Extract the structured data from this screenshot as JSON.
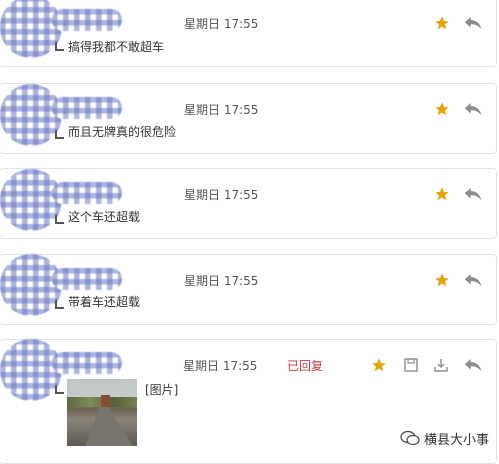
{
  "colors": {
    "star": "#e8a300",
    "status": "#cc3a3a",
    "icon": "#8c8c8c"
  },
  "messages": [
    {
      "date": "星期日 17:55",
      "text": "搞得我都不敢超车",
      "starred": true
    },
    {
      "date": "星期日 17:55",
      "text": "而且无牌真的很危险",
      "starred": true
    },
    {
      "date": "星期日 17:55",
      "text": "这个车还超载",
      "starred": true
    },
    {
      "date": "星期日 17:55",
      "text": "带着车还超载",
      "starred": true
    },
    {
      "date": "星期日 17:55",
      "status": "已回复",
      "attachment_label": "[图片]",
      "starred": true
    }
  ],
  "watermark": "横县大小事"
}
